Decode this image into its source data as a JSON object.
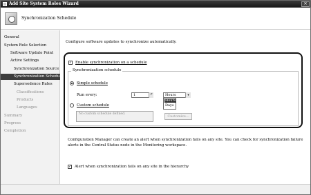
{
  "window": {
    "title": "Add Site System Roles Wizard",
    "close_glyph": "✕"
  },
  "header": {
    "title": "Synchronization Schedule"
  },
  "nav": {
    "items": [
      {
        "label": "General"
      },
      {
        "label": "System Role Selection"
      },
      {
        "label": "Software Update Point"
      },
      {
        "label": "Active Settings"
      },
      {
        "label": "Synchronization Source"
      },
      {
        "label": "Synchronization Schedule"
      },
      {
        "label": "Supersedence Rules"
      },
      {
        "label": "Classifications"
      },
      {
        "label": "Products"
      },
      {
        "label": "Languages"
      },
      {
        "label": "Summary"
      },
      {
        "label": "Progress"
      },
      {
        "label": "Completion"
      }
    ],
    "selected_index": 5
  },
  "main": {
    "intro": "Configure software updates to synchronize automatically.",
    "enable_checkbox": {
      "label": "Enable synchronization on a schedule",
      "checked": true,
      "glyph": "✓"
    },
    "group_label": "Synchronization schedule",
    "simple_schedule": {
      "label": "Simple schedule",
      "selected": true
    },
    "run_every": {
      "label": "Run every:",
      "value": "1",
      "spin_glyph": "▴▾"
    },
    "unit_select": {
      "value": "Hours",
      "arrow_glyph": "▾",
      "options": [
        "Hours",
        "Days"
      ],
      "highlighted": "Hours"
    },
    "custom_schedule": {
      "label": "Custom schedule",
      "selected": false
    },
    "custom_placeholder": "No custom schedule defined.",
    "customize_button": "Customize...",
    "info_text": "Configuration Manager can create an alert when synchronization fails on any site. You can check for synchronization failure alerts in the Central Status node in the Monitoring workspace.",
    "alert_checkbox": {
      "label": "Alert when synchronization fails on any site in the hierarchy",
      "checked": true,
      "glyph": "✓"
    }
  }
}
